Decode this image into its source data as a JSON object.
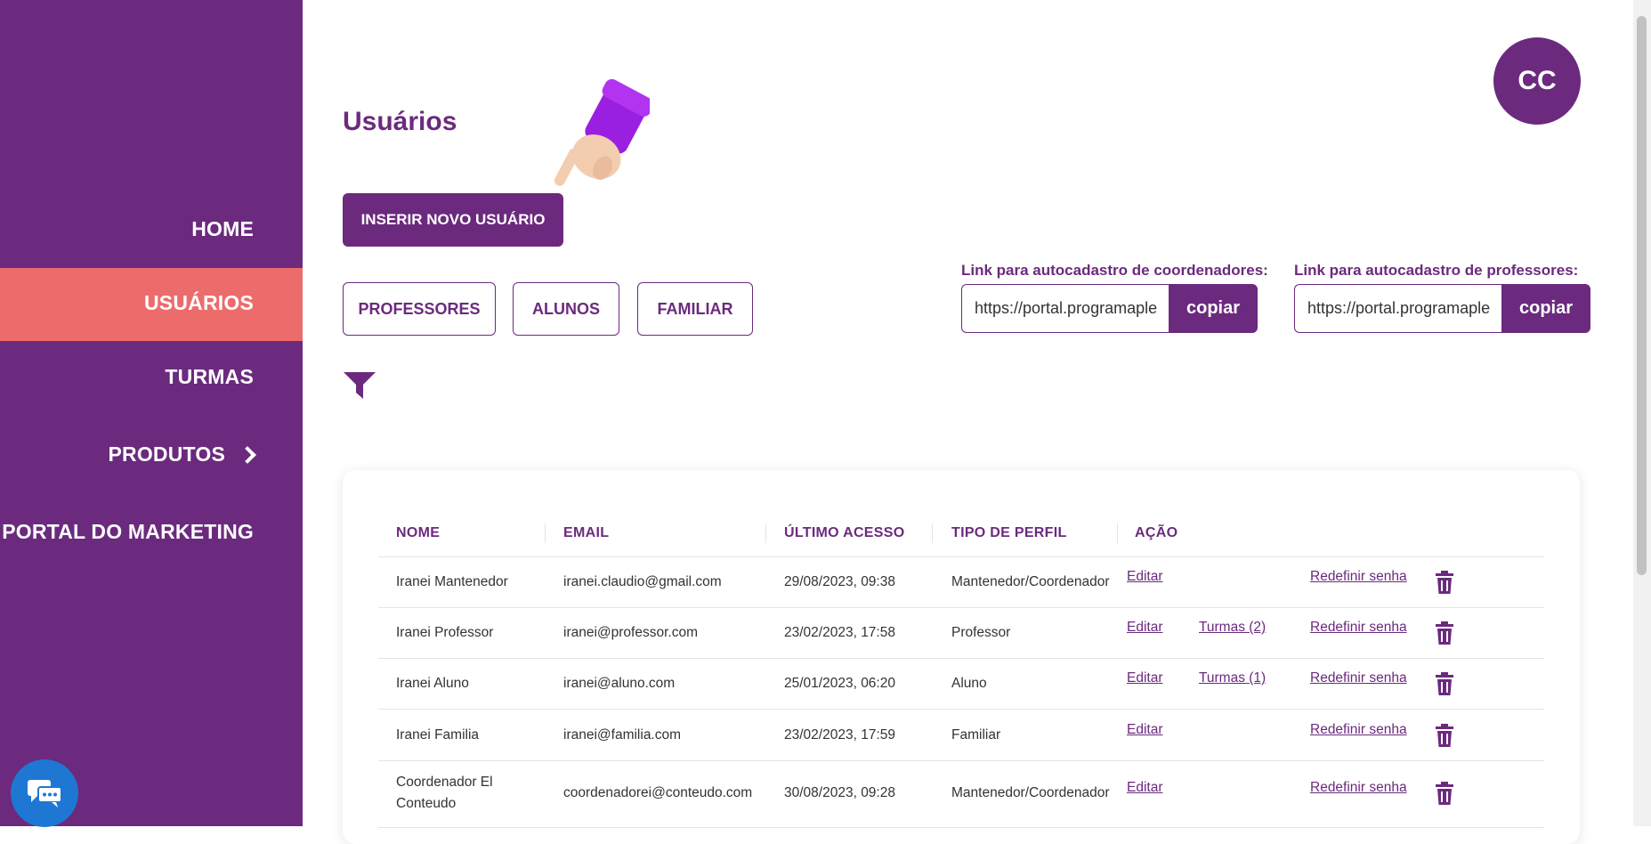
{
  "sidebar": {
    "items": [
      {
        "label": "HOME"
      },
      {
        "label": "USUÁRIOS"
      },
      {
        "label": "TURMAS"
      },
      {
        "label": "PRODUTOS"
      },
      {
        "label": "PORTAL DO MARKETING"
      }
    ],
    "active": "USUÁRIOS",
    "chat_icon": "chat-bubble-icon"
  },
  "header": {
    "title": "Usuários",
    "avatar_initials": "CC",
    "new_user_button": "INSERIR NOVO USUÁRIO"
  },
  "filters": {
    "buttons": [
      "PROFESSORES",
      "ALUNOS",
      "FAMILIAR"
    ],
    "filter_icon": "funnel-icon"
  },
  "links": {
    "coordinators": {
      "label": "Link para autocadastro de coordenadores:",
      "value": "https://portal.programaple",
      "button": "copiar"
    },
    "teachers": {
      "label": "Link para autocadastro de professores:",
      "value": "https://portal.programaple",
      "button": "copiar"
    }
  },
  "table": {
    "headers": [
      "NOME",
      "EMAIL",
      "ÚLTIMO ACESSO",
      "TIPO DE PERFIL",
      "AÇÃO"
    ],
    "rows": [
      {
        "name": "Iranei Mantenedor",
        "email": "iranei.claudio@gmail.com",
        "last_access": "29/08/2023, 09:38",
        "profile": "Mantenedor/Coordenador",
        "edit": "Editar",
        "turmas": "",
        "reset": "Redefinir senha"
      },
      {
        "name": "Iranei Professor",
        "email": "iranei@professor.com",
        "last_access": "23/02/2023, 17:58",
        "profile": "Professor",
        "edit": "Editar",
        "turmas": "Turmas (2)",
        "reset": "Redefinir senha"
      },
      {
        "name": "Iranei Aluno",
        "email": "iranei@aluno.com",
        "last_access": "25/01/2023, 06:20",
        "profile": "Aluno",
        "edit": "Editar",
        "turmas": "Turmas (1)",
        "reset": "Redefinir senha"
      },
      {
        "name": "Iranei Familia",
        "email": "iranei@familia.com",
        "last_access": "23/02/2023, 17:59",
        "profile": "Familiar",
        "edit": "Editar",
        "turmas": "",
        "reset": "Redefinir senha"
      },
      {
        "name": "Coordenador El Conteudo",
        "email": "coordenadorei@conteudo.com",
        "last_access": "30/08/2023, 09:28",
        "profile": "Mantenedor/Coordenador",
        "edit": "Editar",
        "turmas": "",
        "reset": "Redefinir senha"
      }
    ],
    "delete_icon": "trash-icon"
  },
  "colors": {
    "primary": "#6b2a7e",
    "active_nav": "#ec6c6c",
    "chat": "#1e77d3"
  }
}
